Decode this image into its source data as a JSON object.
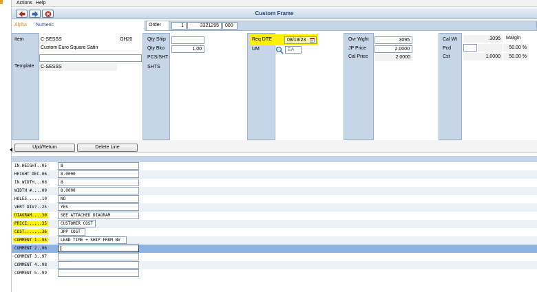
{
  "menu": {
    "actions": "Actions",
    "help": "Help"
  },
  "window": {
    "title": "Custom Frame"
  },
  "tabs": {
    "alpha": "Alpha",
    "numeric": "Numeric"
  },
  "colors": {
    "panel": "#c6d6e8",
    "highlight": "#fff000",
    "selected_row": "#8db3e2",
    "alpha_tab": "#e08a1c",
    "numeric_tab": "#1b4fa0"
  },
  "order": {
    "label": "Order",
    "line": "1",
    "number": "3321295",
    "suffix": "000"
  },
  "item": {
    "label": "Item",
    "code": "C-SESSS",
    "location": "OH20",
    "description": "Custom Euro Square Satin",
    "extra": "",
    "template_label": "Template",
    "template": "C-SESSS"
  },
  "qty": {
    "ship_label": "Qty Ship",
    "ship": "",
    "bko_label": "Qty Bko",
    "bko": "1.00",
    "pcs_label": "PCS/SHT",
    "shts_label": "SHTS"
  },
  "req": {
    "dte_label": "Req DTE",
    "dte": "08/18/23",
    "um_label": "UM",
    "um": "EA"
  },
  "price": {
    "ovr_wght_label": "Ovr Wght",
    "ovr_wght": "3095",
    "jp_price_label": "JP Price",
    "jp_price": "2.0000",
    "cal_price_label": "Cal Price",
    "cal_price": "2.0000"
  },
  "cal": {
    "wt_label": "Cal Wt",
    "wt": ".3095",
    "margin_label": "Margin",
    "pcd_label": "Pcd",
    "pcd": "",
    "pcd_margin": "50.00 %",
    "cst_label": "Cst",
    "cst": "1.0000",
    "cst_margin": "50.00 %"
  },
  "buttons": {
    "upd_return": "Upd/Return",
    "delete_line": "Delete Line"
  },
  "spec_rows": [
    {
      "label": "IN HEIGHT..05",
      "value": "8"
    },
    {
      "label": "HEIGHT DEC.06",
      "value": "8.0000"
    },
    {
      "label": "IN WIDTH...08",
      "value": "8"
    },
    {
      "label": "WIDTH #....09",
      "value": "8.0000"
    },
    {
      "label": "HOLES......10",
      "value": "NO"
    },
    {
      "label": "VERT DIV?..25",
      "value": "YES"
    },
    {
      "label": "DIAGRAM....30",
      "value": "SEE ATTACHED DIAGRAM"
    },
    {
      "label": "PRICE......35",
      "value": "CUSTOMER COST"
    },
    {
      "label": "COST.......36",
      "value": "JPP COST"
    },
    {
      "label": "COMMENT 1..95",
      "value": "LEAD TIME + SHIP FROM NV"
    },
    {
      "label": "COMMENT 2..96",
      "value": ""
    },
    {
      "label": "COMMENT 3..97",
      "value": ""
    },
    {
      "label": "COMMENT 4..98",
      "value": ""
    },
    {
      "label": "COMMENT 5..99",
      "value": ""
    }
  ]
}
